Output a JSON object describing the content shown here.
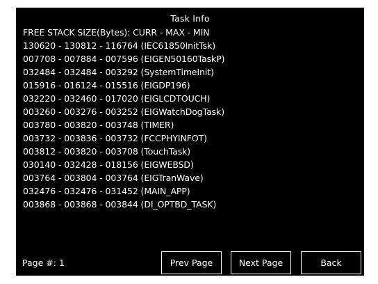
{
  "window": {
    "title": "Task Info"
  },
  "header": {
    "columns_label": "FREE STACK SIZE(Bytes): CURR - MAX - MIN"
  },
  "tasks": [
    "130620 - 130812 - 116764  (IEC61850InitTsk)",
    "007708 - 007884 - 007596  (EIGEN50160TaskP)",
    "032484 - 032484 - 003292  (SystemTimeInit)",
    "015916 - 016124 - 015516  (EIGDP196)",
    "032220 - 032460 - 017020  (EIGLCDTOUCH)",
    "003260 - 003276 - 003252  (EIGWatchDogTask)",
    "003780 - 003820 - 003748  (TIMER)",
    "003732 - 003836 - 003732  (FCCPHYINFOT)",
    "003812 - 003820 - 003708  (TouchTask)",
    "030140 - 032428 - 018156  (EIGWEBSD)",
    "003764 - 003804 - 003764  (EIGTranWave)",
    "032476 - 032476 - 031452  (MAIN_APP)",
    "003868 - 003868 - 003844  (DI_OPTBD_TASK)"
  ],
  "footer": {
    "page_label": "Page #: 1",
    "prev_label": "Prev Page",
    "next_label": "Next Page",
    "back_label": "Back"
  },
  "colors": {
    "background": "#000000",
    "text": "#ffffff",
    "button_border": "#ffffff"
  }
}
